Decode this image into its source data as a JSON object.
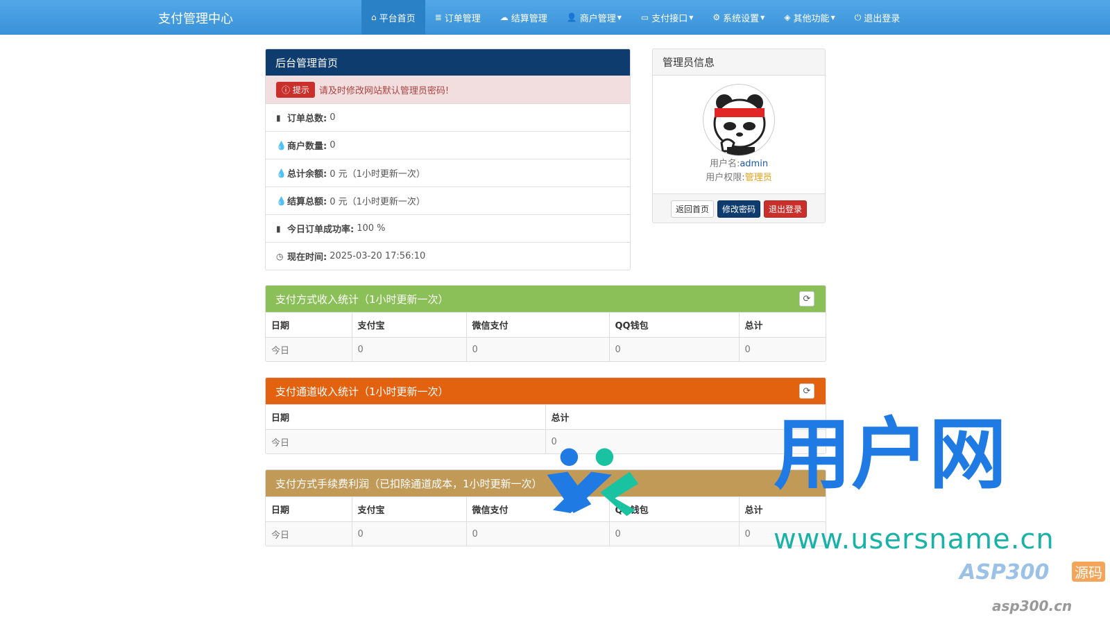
{
  "navbar": {
    "brand": "支付管理中心",
    "items": [
      {
        "label": "平台首页",
        "icon": "home-icon",
        "glyph": "⌂",
        "dropdown": false,
        "active": true
      },
      {
        "label": "订单管理",
        "icon": "list-icon",
        "glyph": "≣",
        "dropdown": false
      },
      {
        "label": "结算管理",
        "icon": "cloud-icon",
        "glyph": "☁",
        "dropdown": false
      },
      {
        "label": "商户管理",
        "icon": "user-icon",
        "glyph": "👤",
        "dropdown": true
      },
      {
        "label": "支付接口",
        "icon": "card-icon",
        "glyph": "▭",
        "dropdown": true
      },
      {
        "label": "系统设置",
        "icon": "gear-icon",
        "glyph": "⚙",
        "dropdown": true
      },
      {
        "label": "其他功能",
        "icon": "cube-icon",
        "glyph": "◈",
        "dropdown": true
      },
      {
        "label": "退出登录",
        "icon": "power-icon",
        "glyph": "⏻",
        "dropdown": false
      }
    ]
  },
  "dashboard": {
    "title": "后台管理首页",
    "tip_badge": "提示",
    "tip_text": "请及时修改网站默认管理员密码!",
    "stats": [
      {
        "icon": "bar-chart-icon",
        "glyph": "▮",
        "label": "订单总数:",
        "value": "0"
      },
      {
        "icon": "drop-icon",
        "glyph": "💧",
        "label": "商户数量:",
        "value": "0"
      },
      {
        "icon": "drop-icon",
        "glyph": "💧",
        "label": "总计余额:",
        "value": "0 元（1小时更新一次）"
      },
      {
        "icon": "drop-icon",
        "glyph": "💧",
        "label": "结算总额:",
        "value": "0 元（1小时更新一次）"
      },
      {
        "icon": "bar-chart-icon",
        "glyph": "▮",
        "label": "今日订单成功率:",
        "value": "100 %"
      },
      {
        "icon": "clock-icon",
        "glyph": "◷",
        "label": "现在时间:",
        "value": "2025-03-20 17:56:10"
      }
    ]
  },
  "admin": {
    "title": "管理员信息",
    "username_label": "用户名:",
    "username": "admin",
    "role_label": "用户权限:",
    "role": "管理员",
    "buttons": {
      "home": "返回首页",
      "change_pw": "修改密码",
      "logout": "退出登录"
    }
  },
  "pay_method_income": {
    "title": "支付方式收入统计（1小时更新一次）",
    "headers": [
      "日期",
      "支付宝",
      "微信支付",
      "QQ钱包",
      "总计"
    ],
    "rows": [
      [
        "今日",
        "0",
        "0",
        "0",
        "0"
      ]
    ]
  },
  "channel_income": {
    "title": "支付通道收入统计（1小时更新一次）",
    "headers": [
      "日期",
      "总计"
    ],
    "rows": [
      [
        "今日",
        "0"
      ]
    ]
  },
  "fee_profit": {
    "title": "支付方式手续费利润（已扣除通道成本，1小时更新一次）",
    "headers": [
      "日期",
      "支付宝",
      "微信支付",
      "QQ钱包",
      "总计"
    ],
    "rows": [
      [
        "今日",
        "0",
        "0",
        "0",
        "0"
      ]
    ]
  },
  "watermark": {
    "cn": "用户网",
    "url": "www.usersname.cn",
    "asp": "ASP300",
    "src": "源码",
    "asp_url": "asp300.cn"
  },
  "colors": {
    "navbar": "#3a93d8",
    "navy": "#0e3c6f",
    "green": "#8bbf58",
    "orange": "#e2620f",
    "tan": "#c29a58",
    "danger": "#c9302c"
  }
}
